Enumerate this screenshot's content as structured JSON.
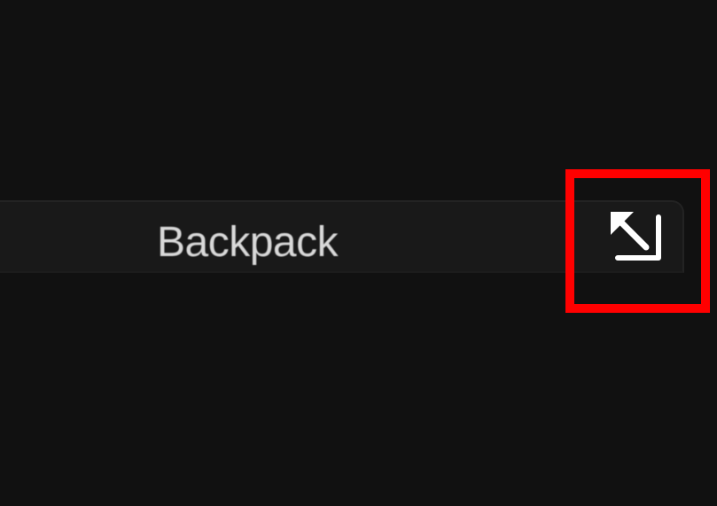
{
  "item_bar": {
    "label": "Backpack",
    "action_icon": "expand-collapse-arrow-icon"
  },
  "highlight": {
    "color": "#ff0000"
  },
  "colors": {
    "background": "#111111",
    "bar": "#191919",
    "text": "#d9d9d9",
    "icon": "#ffffff"
  }
}
